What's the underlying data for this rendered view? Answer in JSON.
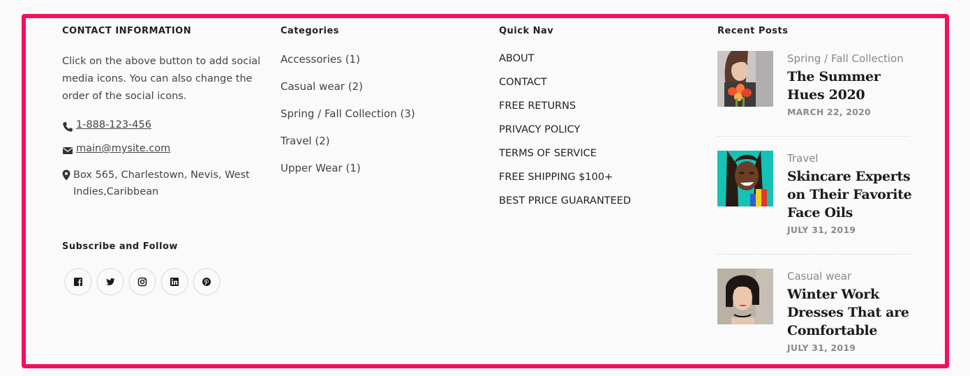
{
  "contact": {
    "heading": "CONTACT INFORMATION",
    "about": "Click on the above button to add social media icons. You can also change the order of the social icons.",
    "phone": "1-888-123-456",
    "email": "main@mysite.com",
    "address": "Box 565, Charlestown, Nevis, West Indies,Caribbean",
    "phone_icon": "phone-icon",
    "email_icon": "envelope-icon",
    "address_icon": "map-marker-icon"
  },
  "subscribe": {
    "heading": "Subscribe and Follow",
    "socials": [
      "facebook-icon",
      "twitter-icon",
      "instagram-icon",
      "linkedin-icon",
      "pinterest-icon"
    ]
  },
  "categories": {
    "heading": "Categories",
    "items": [
      {
        "label": "Accessories",
        "count": "(1)"
      },
      {
        "label": "Casual wear",
        "count": "(2)"
      },
      {
        "label": "Spring / Fall Collection",
        "count": "(3)"
      },
      {
        "label": "Travel",
        "count": "(2)"
      },
      {
        "label": "Upper Wear",
        "count": "(1)"
      }
    ]
  },
  "quick_nav": {
    "heading": "Quick Nav",
    "items": [
      "ABOUT",
      "CONTACT",
      "FREE RETURNS",
      "PRIVACY POLICY",
      "TERMS OF SERVICE",
      "FREE SHIPPING $100+",
      "BEST PRICE GUARANTEED"
    ]
  },
  "recent_posts": {
    "heading": "Recent Posts",
    "posts": [
      {
        "category": "Spring / Fall Collection",
        "title": "The Summer Hues 2020",
        "date": "MARCH 22, 2020"
      },
      {
        "category": "Travel",
        "title": "Skincare Experts on Their Favorite Face Oils",
        "date": "JULY 31, 2019"
      },
      {
        "category": "Casual wear",
        "title": "Winter Work Dresses That are Comfortable",
        "date": "JULY 31, 2019"
      }
    ]
  },
  "colors": {
    "border": "#f50f5a",
    "background": "#fafafa"
  }
}
